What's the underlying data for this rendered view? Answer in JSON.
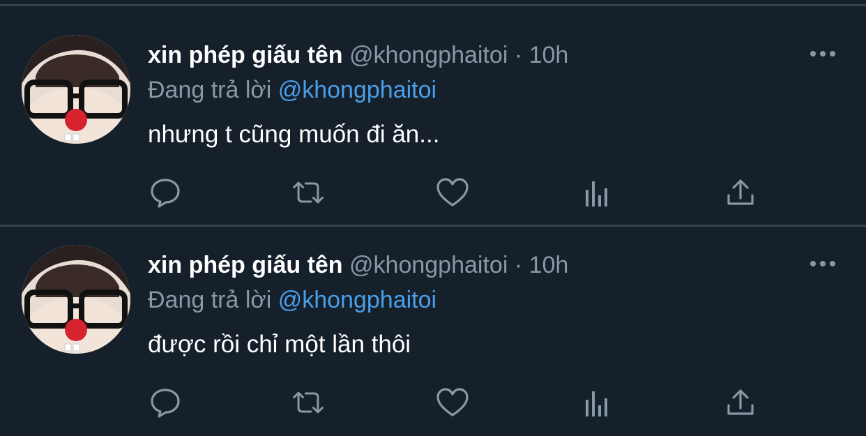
{
  "colors": {
    "background": "#15202b",
    "divider": "#38444d",
    "secondary_text": "#8899a6",
    "mention": "#4a9fe8",
    "icon": "#8899a6"
  },
  "tweets": [
    {
      "display_name": "xin phép giấu tên",
      "handle": "@khongphaitoi",
      "separator": "·",
      "time": "10h",
      "reply_prefix": "Đang trả lời",
      "reply_mention": "@khongphaitoi",
      "text": "nhưng t cũng muốn đi ăn...",
      "actions": [
        "reply-icon",
        "retweet-icon",
        "like-icon",
        "analytics-icon",
        "share-icon"
      ]
    },
    {
      "display_name": "xin phép giấu tên",
      "handle": "@khongphaitoi",
      "separator": "·",
      "time": "10h",
      "reply_prefix": "Đang trả lời",
      "reply_mention": "@khongphaitoi",
      "text": "được rồi chỉ một lần thôi",
      "actions": [
        "reply-icon",
        "retweet-icon",
        "like-icon",
        "analytics-icon",
        "share-icon"
      ]
    }
  ]
}
